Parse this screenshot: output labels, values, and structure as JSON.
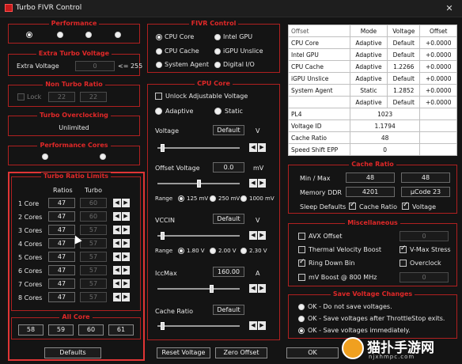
{
  "window": {
    "title": "Turbo FIVR Control",
    "close_glyph": "✕"
  },
  "performance": {
    "title": "Performance",
    "radios": [
      true,
      false,
      false,
      false
    ]
  },
  "extra_turbo": {
    "title": "Extra Turbo Voltage",
    "label": "Extra Voltage",
    "value": "0",
    "suffix": "<= 255"
  },
  "non_turbo": {
    "title": "Non Turbo Ratio",
    "lock_label": "Lock",
    "value1": "22",
    "value2": "22"
  },
  "turbo_overclocking": {
    "title": "Turbo Overclocking",
    "value": "Unlimited"
  },
  "performance_cores": {
    "title": "Performance Cores"
  },
  "turbo_ratio_limits": {
    "title": "Turbo Ratio Limits",
    "col_ratios": "Ratios",
    "col_turbo": "Turbo",
    "rows": [
      {
        "label": "1 Core",
        "ratio": "47",
        "turbo": "60"
      },
      {
        "label": "2 Cores",
        "ratio": "47",
        "turbo": "60"
      },
      {
        "label": "3 Cores",
        "ratio": "47",
        "turbo": "57"
      },
      {
        "label": "4 Cores",
        "ratio": "47",
        "turbo": "57"
      },
      {
        "label": "5 Cores",
        "ratio": "47",
        "turbo": "57"
      },
      {
        "label": "6 Cores",
        "ratio": "47",
        "turbo": "57"
      },
      {
        "label": "7 Cores",
        "ratio": "47",
        "turbo": "57"
      },
      {
        "label": "8 Cores",
        "ratio": "47",
        "turbo": "57"
      }
    ]
  },
  "all_core": {
    "title": "All Core",
    "values": [
      "58",
      "59",
      "60",
      "61"
    ]
  },
  "buttons": {
    "defaults": "Defaults",
    "reset_voltage": "Reset Voltage",
    "zero_offset": "Zero Offset",
    "ok": "OK"
  },
  "fivr_control": {
    "title": "FIVR Control",
    "options": [
      {
        "label": "CPU Core",
        "selected": true
      },
      {
        "label": "Intel GPU",
        "selected": false
      },
      {
        "label": "CPU Cache",
        "selected": false
      },
      {
        "label": "iGPU Unslice",
        "selected": false
      },
      {
        "label": "System Agent",
        "selected": false
      },
      {
        "label": "Digital I/O",
        "selected": false
      }
    ]
  },
  "cpu_core": {
    "title": "CPU Core",
    "unlock_label": "Unlock Adjustable Voltage",
    "adaptive_label": "Adaptive",
    "static_label": "Static",
    "voltage_label": "Voltage",
    "voltage_value": "Default",
    "voltage_unit": "V",
    "offset_label": "Offset Voltage",
    "offset_value": "0.0",
    "offset_unit": "mV",
    "range_label": "Range",
    "offset_ranges": [
      "125 mV",
      "250 mV",
      "1000 mV"
    ],
    "vccin_label": "VCCIN",
    "vccin_value": "Default",
    "vccin_unit": "V",
    "vccin_ranges": [
      "1.80 V",
      "2.00 V",
      "2.30 V"
    ],
    "iccmax_label": "IccMax",
    "iccmax_value": "160.00",
    "iccmax_unit": "A",
    "cache_ratio_label": "Cache Ratio",
    "cache_ratio_value": "Default"
  },
  "status_table": {
    "header": [
      "Offset",
      "Mode",
      "Voltage",
      "Offset"
    ],
    "rows": [
      [
        "CPU Core",
        "Adaptive",
        "Default",
        "+0.0000"
      ],
      [
        "Intel GPU",
        "Adaptive",
        "Default",
        "+0.0000"
      ],
      [
        "CPU Cache",
        "Adaptive",
        "1.2266",
        "+0.0000"
      ],
      [
        "iGPU Unslice",
        "Adaptive",
        "Default",
        "+0.0000"
      ],
      [
        "System Agent",
        "Static",
        "1.2852",
        "+0.0000"
      ],
      [
        "",
        "Adaptive",
        "Default",
        "+0.0000"
      ]
    ],
    "info_rows": [
      [
        "PL4",
        "1023"
      ],
      [
        "Voltage ID",
        "1.1794"
      ],
      [
        "Cache Ratio",
        "48"
      ],
      [
        "Speed Shift EPP",
        "0"
      ]
    ]
  },
  "cache_ratio": {
    "title": "Cache Ratio",
    "minmax_label": "Min / Max",
    "min": "48",
    "max": "48",
    "memory_label": "Memory DDR",
    "memory_value": "4201",
    "ucode": "µCode 23",
    "sleep_label": "Sleep Defaults",
    "cache_ratio_check": "Cache Ratio",
    "voltage_check": "Voltage"
  },
  "misc": {
    "title": "Miscellaneous",
    "avx_label": "AVX Offset",
    "avx_value": "0",
    "tvb_label": "Thermal Velocity Boost",
    "vmax_label": "V-Max Stress",
    "ringdown_label": "Ring Down Bin",
    "overclock_label": "Overclock",
    "mv_boost_label": "mV Boost @ 800 MHz",
    "mv_boost_value": "0"
  },
  "save_voltage": {
    "title": "Save Voltage Changes",
    "options": [
      {
        "label": "OK - Do not save voltages.",
        "selected": false
      },
      {
        "label": "OK - Save voltages after ThrottleStop exits.",
        "selected": false
      },
      {
        "label": "OK - Save voltages immediately.",
        "selected": true
      }
    ]
  },
  "watermark": {
    "text": "猫扑手游网",
    "url": "njxhmpc.com"
  }
}
